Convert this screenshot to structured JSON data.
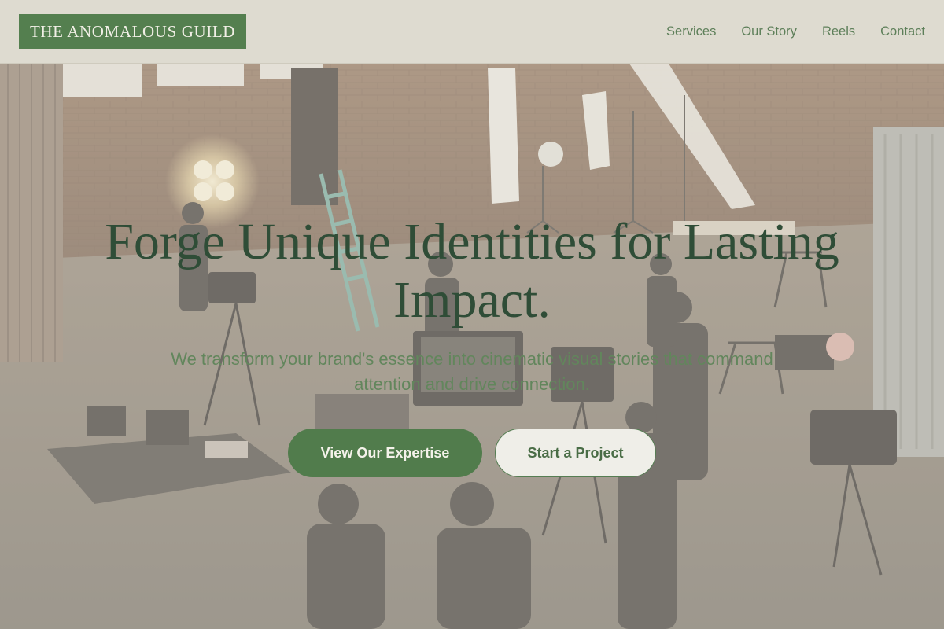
{
  "brand": {
    "name": "THE ANOMALOUS GUILD"
  },
  "nav": {
    "items": [
      {
        "label": "Services"
      },
      {
        "label": "Our Story"
      },
      {
        "label": "Reels"
      },
      {
        "label": "Contact"
      }
    ]
  },
  "hero": {
    "headline": "Forge Unique Identities for Lasting Impact.",
    "subheadline": "We transform your brand's essence into cinematic visual stories that command attention and drive connection.",
    "primary_cta": "View Our Expertise",
    "secondary_cta": "Start a Project",
    "background": "film-production-warehouse-photo"
  },
  "colors": {
    "brand_green": "#547f4f",
    "header_bg": "#dedbd0",
    "headline": "#2f4d37",
    "nav_text": "#5d7f59"
  }
}
